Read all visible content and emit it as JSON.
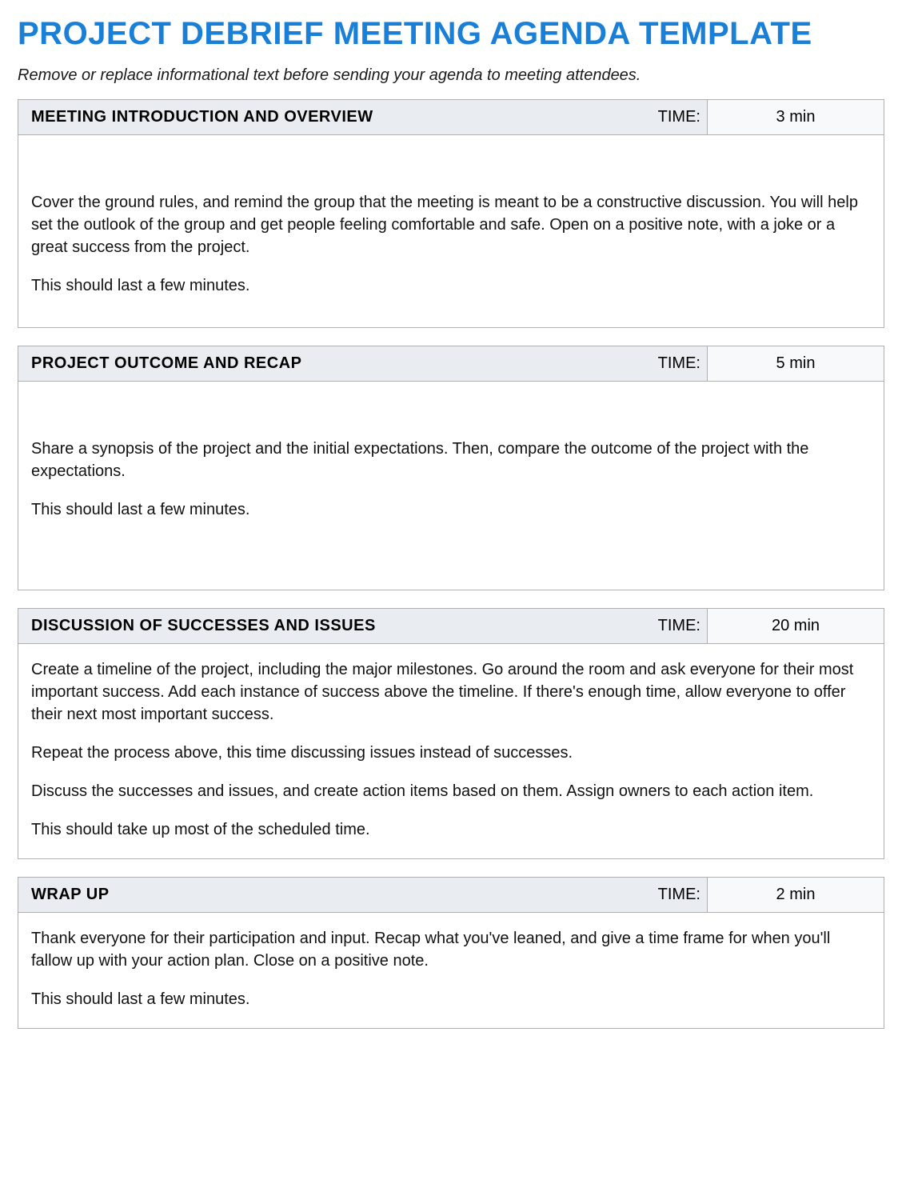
{
  "title": "PROJECT DEBRIEF MEETING AGENDA TEMPLATE",
  "instruction": "Remove or replace informational text before sending your agenda to meeting attendees.",
  "time_label": "TIME:",
  "sections": [
    {
      "heading": "MEETING INTRODUCTION AND OVERVIEW",
      "time": "3 min",
      "paragraphs": [
        "Cover the ground rules, and remind the group that the meeting is meant to be a constructive discussion. You will help set the outlook of the group and get people feeling comfortable and safe. Open on a positive note, with a joke or a great success from the project.",
        "This should last a few minutes."
      ]
    },
    {
      "heading": "PROJECT OUTCOME AND RECAP",
      "time": "5 min",
      "paragraphs": [
        "Share a synopsis of the project and the initial expectations. Then, compare the outcome of the project with the expectations.",
        "This should last a few minutes."
      ]
    },
    {
      "heading": "DISCUSSION OF SUCCESSES AND ISSUES",
      "time": "20 min",
      "paragraphs": [
        "Create a timeline of the project, including the major milestones. Go around the room and ask everyone for their most important success. Add each instance of success above the timeline. If there's enough time, allow everyone to offer their next most important success.",
        "Repeat the process above, this time discussing issues instead of successes.",
        "Discuss the successes and issues, and create action items based on them. Assign owners to each action item.",
        "This should take up most of the scheduled time."
      ]
    },
    {
      "heading": "WRAP UP",
      "time": "2 min",
      "paragraphs": [
        "Thank everyone for their participation and input. Recap what you've leaned, and give a time frame for when you'll fallow up with your action plan. Close on a positive note.",
        "This should last a few minutes."
      ]
    }
  ]
}
